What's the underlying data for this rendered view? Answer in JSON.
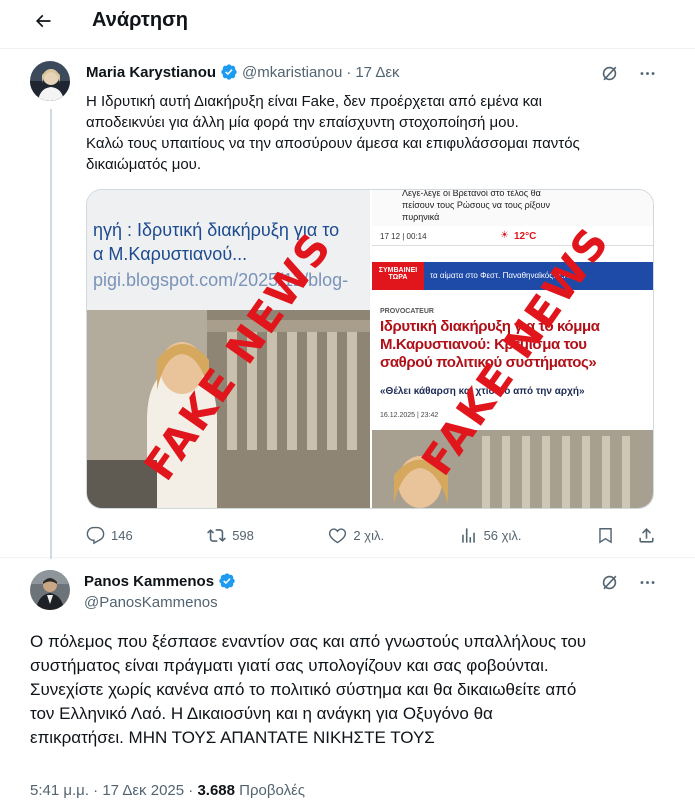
{
  "header": {
    "title": "Ανάρτηση",
    "back_icon": "arrow-left-icon"
  },
  "colors": {
    "accent": "#1d9bf0",
    "verified": "#1d9bf0",
    "muted": "#536471",
    "fake_news": "#e0161c",
    "border": "#eff3f4"
  },
  "quoted_post": {
    "author_name": "Maria Karystianou",
    "handle": "@mkaristianou",
    "separator": "·",
    "date": "17 Δεκ",
    "text_lines": [
      "Η Ιδρυτική αυτή Διακήρυξη είναι Fake, δεν προέρχεται από εμένα και",
      "αποδεικνύει για άλλη μία φορά την επαίσχυντη στοχοποίησή μου.",
      "Καλώ τους υπαιτίους να την αποσύρουν άμεσα και επιφυλάσσομαι παντός",
      "δικαιώματός μου."
    ],
    "media_left": {
      "line1": "ηγή  : Ιδρυτική διακήρυξη για το",
      "line2": "α Μ.Καρυστιανού...",
      "url": "pigi.blogspot.com/2025/12/blog-",
      "stamp": "FAKE NEWS"
    },
    "media_right": {
      "top_line1": "Λεγε-λεγε οι Βρετανοί στο τέλος θα",
      "top_line2": "πείσουν τους Ρώσους να τους ρίξουν",
      "top_line3": "πυρηνικά",
      "date_bar": "17 12 | 00:14",
      "temperature": "12°C",
      "ticker_badge_line1": "ΣΥΜΒΑΙΝΕΙ",
      "ticker_badge_line2": "ΤΩΡΑ",
      "ticker_text": "τα αίματα στο Φεστ. Παναθηναϊκός: Τ.Κκ",
      "kicker": "PROVOCATEUR",
      "headline_1": "Ιδρυτική διακήρυξη για το κόμμα",
      "headline_2": "Μ.Καρυστιανού: Κρέμισμα του",
      "headline_3": "σαθρού πολιτικού συστήματος»",
      "quote": "«Θέλει κάθαρση και χτίσιμο από την αρχή»",
      "timestamp": "16.12.2025 | 23:42",
      "stamp": "FAKE NEWS"
    },
    "stats": {
      "replies": "146",
      "reposts": "598",
      "likes": "2 χιλ.",
      "views": "56 χιλ."
    }
  },
  "main_post": {
    "author_name": "Panos Kammenos",
    "handle": "@PanosKammenos",
    "text_lines": [
      "Ο πόλεμος που ξέσπασε εναντίον σας και από γνωστούς υπαλλήλους του",
      "συστήματος είναι πράγματι γιατί σας υπολογίζουν και σας φοβούνται.",
      "Συνεχίστε χωρίς κανένα από το πολιτικό σύστημα και θα δικαιωθείτε από",
      "τον Ελληνικό Λαό. Η Δικαιοσύνη και η ανάγκη για Οξυγόνο θα",
      "επικρατήσει. ΜΗΝ ΤΟΥΣ ΑΠΑΝΤΑΤΕ ΝΙΚΗΣΤΕ ΤΟΥΣ"
    ],
    "time": "5:41 μ.μ.",
    "dot": "·",
    "date": "17 Δεκ 2025",
    "views_count": "3.688",
    "views_label": "Προβολές"
  }
}
